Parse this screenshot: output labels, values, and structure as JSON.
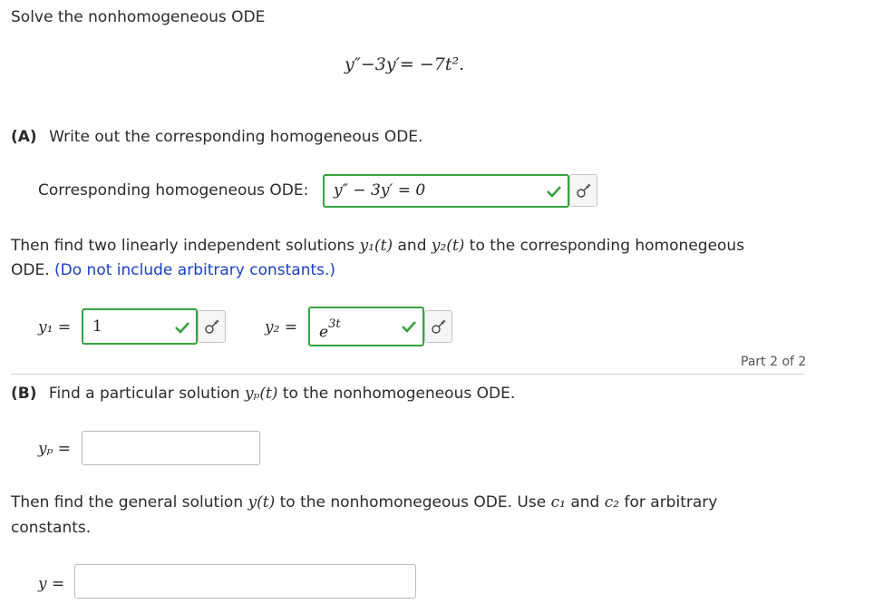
{
  "intro": "Solve the nonhomogeneous ODE",
  "equation": "y″−3y′= −7t².",
  "partA": {
    "label": "(A)",
    "prompt": "Write out the corresponding homogeneous ODE.",
    "homog_label": "Corresponding homogeneous ODE:",
    "homog_value": "y″ − 3y′ = 0",
    "then_text_1": "Then find two linearly independent solutions ",
    "y1_sym": "y₁(t)",
    "and": " and ",
    "y2_sym": "y₂(t)",
    "then_text_2": " to the corresponding homonegeous",
    "then_text_3": "ODE. ",
    "note": "(Do not include arbitrary constants.)",
    "y1_label": "y₁ =",
    "y1_value": "1",
    "y2_label": "y₂ =",
    "y2_value": "e",
    "y2_exp": "3t"
  },
  "part_indicator": "Part 2 of 2",
  "partB": {
    "label": "(B)",
    "prompt_1": "Find a particular solution ",
    "yp_sym": "yₚ(t)",
    "prompt_2": " to the nonhomogeneous ODE.",
    "yp_label": "yₚ =",
    "yp_value": "",
    "general_1": "Then find the general solution ",
    "y_sym": "y(t)",
    "general_2": " to the nonhomonegeous ODE. Use ",
    "c1": "c₁",
    "and": " and ",
    "c2": "c₂",
    "general_3": " for arbitrary",
    "general_4": "constants.",
    "y_label": "y =",
    "y_value": ""
  },
  "colors": {
    "correct": "#36a33c",
    "note": "#1a3fc9"
  }
}
